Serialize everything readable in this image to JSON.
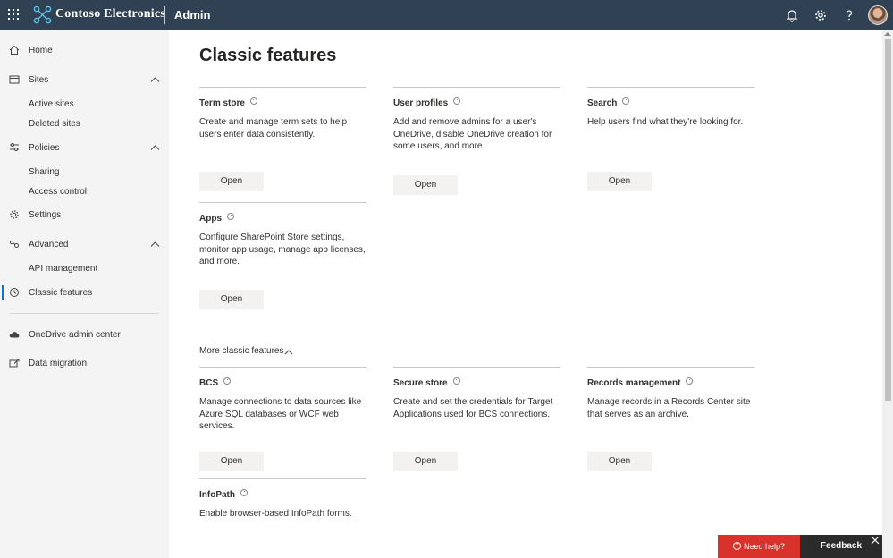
{
  "topbar": {
    "brand": "Contoso Electronics",
    "app": "Admin",
    "icons": [
      "app-launcher-icon",
      "contoso-logo-icon",
      "bell-icon",
      "gear-icon",
      "help-icon",
      "avatar"
    ]
  },
  "sidebar": {
    "items": [
      {
        "label": "Home",
        "icon": "home-icon"
      },
      {
        "label": "Sites",
        "icon": "sites-icon",
        "expanded": true,
        "children": [
          "Active sites",
          "Deleted sites"
        ]
      },
      {
        "label": "Policies",
        "icon": "policies-icon",
        "expanded": true,
        "children": [
          "Sharing",
          "Access control"
        ]
      },
      {
        "label": "Settings",
        "icon": "gear-icon"
      },
      {
        "label": "Advanced",
        "icon": "advanced-icon",
        "expanded": true,
        "children": [
          "API management"
        ]
      },
      {
        "label": "Classic features",
        "icon": "history-icon",
        "selected": true
      },
      {
        "label": "OneDrive admin center",
        "icon": "cloud-icon"
      },
      {
        "label": "Data migration",
        "icon": "migration-icon"
      }
    ]
  },
  "main": {
    "title": "Classic features",
    "more_label": "More classic features",
    "open_label": "Open",
    "cards": [
      {
        "title": "Term store",
        "description": "Create and manage term sets to help users enter data consistently."
      },
      {
        "title": "User profiles",
        "description": "Add and remove admins for a user's OneDrive, disable OneDrive creation for some users, and more."
      },
      {
        "title": "Search",
        "description": "Help users find what they're looking for."
      },
      {
        "title": "Apps",
        "description": "Configure SharePoint Store settings, monitor app usage, manage app licenses, and more."
      }
    ],
    "more_cards": [
      {
        "title": "BCS",
        "description": "Manage connections to data sources like Azure SQL databases or WCF web services."
      },
      {
        "title": "Secure store",
        "description": "Create and set the credentials for Target Applications used for BCS connections."
      },
      {
        "title": "Records management",
        "description": "Manage records in a Records Center site that serves as an archive."
      },
      {
        "title": "InfoPath",
        "description": "Enable browser-based InfoPath forms."
      }
    ]
  },
  "footer": {
    "need_help": "Need help?",
    "feedback": "Feedback"
  },
  "colors": {
    "topbar": "#2f4153",
    "sidebar": "#f4f4f4",
    "accent": "#0078d4",
    "need_help": "#d9322a",
    "feedback": "#2b2b2b"
  }
}
